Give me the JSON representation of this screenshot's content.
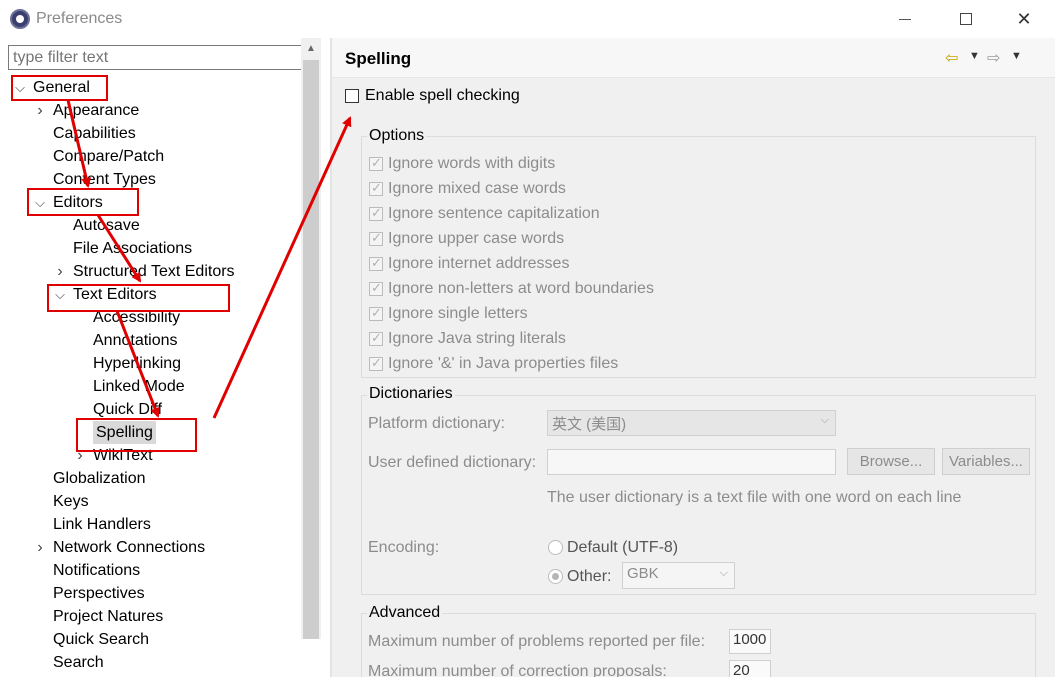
{
  "window": {
    "title": "Preferences"
  },
  "filter": {
    "placeholder": "type filter text"
  },
  "tree": [
    {
      "label": "General",
      "twisty": "open"
    },
    {
      "label": "Appearance",
      "twisty": "closed"
    },
    {
      "label": "Capabilities",
      "twisty": ""
    },
    {
      "label": "Compare/Patch",
      "twisty": ""
    },
    {
      "label": "Content Types",
      "twisty": ""
    },
    {
      "label": "Editors",
      "twisty": "open"
    },
    {
      "label": "Autosave",
      "twisty": ""
    },
    {
      "label": "File Associations",
      "twisty": ""
    },
    {
      "label": "Structured Text Editors",
      "twisty": "closed"
    },
    {
      "label": "Text Editors",
      "twisty": "open"
    },
    {
      "label": "Accessibility",
      "twisty": ""
    },
    {
      "label": "Annotations",
      "twisty": ""
    },
    {
      "label": "Hyperlinking",
      "twisty": ""
    },
    {
      "label": "Linked Mode",
      "twisty": ""
    },
    {
      "label": "Quick Diff",
      "twisty": ""
    },
    {
      "label": "Spelling",
      "twisty": "",
      "selected": true
    },
    {
      "label": "WikiText",
      "twisty": "closed"
    },
    {
      "label": "Globalization",
      "twisty": ""
    },
    {
      "label": "Keys",
      "twisty": ""
    },
    {
      "label": "Link Handlers",
      "twisty": ""
    },
    {
      "label": "Network Connections",
      "twisty": "closed"
    },
    {
      "label": "Notifications",
      "twisty": ""
    },
    {
      "label": "Perspectives",
      "twisty": ""
    },
    {
      "label": "Project Natures",
      "twisty": ""
    },
    {
      "label": "Quick Search",
      "twisty": ""
    },
    {
      "label": "Search",
      "twisty": ""
    }
  ],
  "page": {
    "title": "Spelling",
    "enable_label": "Enable spell checking",
    "enable_checked": false,
    "options_title": "Options",
    "options": [
      "Ignore words with digits",
      "Ignore mixed case words",
      "Ignore sentence capitalization",
      "Ignore upper case words",
      "Ignore internet addresses",
      "Ignore non-letters at word boundaries",
      "Ignore single letters",
      "Ignore Java string literals",
      "Ignore '&' in Java properties files"
    ],
    "dictionaries_title": "Dictionaries",
    "platform_dict_label": "Platform dictionary:",
    "platform_dict_value": "英文 (美国)",
    "user_dict_label": "User defined dictionary:",
    "user_dict_value": "",
    "browse_label": "Browse...",
    "variables_label": "Variables...",
    "user_dict_hint": "The user dictionary is a text file with one word on each line",
    "encoding_label": "Encoding:",
    "default_encoding_label": "Default (UTF-8)",
    "other_encoding_label": "Other:",
    "other_encoding_value": "GBK",
    "encoding_selected": "Other",
    "advanced_title": "Advanced",
    "max_problems_label": "Maximum number of problems reported per file:",
    "max_problems_value": "1000",
    "max_proposals_label": "Maximum number of correction proposals:",
    "max_proposals_value": "20"
  },
  "icons": {
    "back": "back-arrow-icon",
    "forward": "forward-arrow-icon"
  },
  "annotation_color": "#e00000"
}
